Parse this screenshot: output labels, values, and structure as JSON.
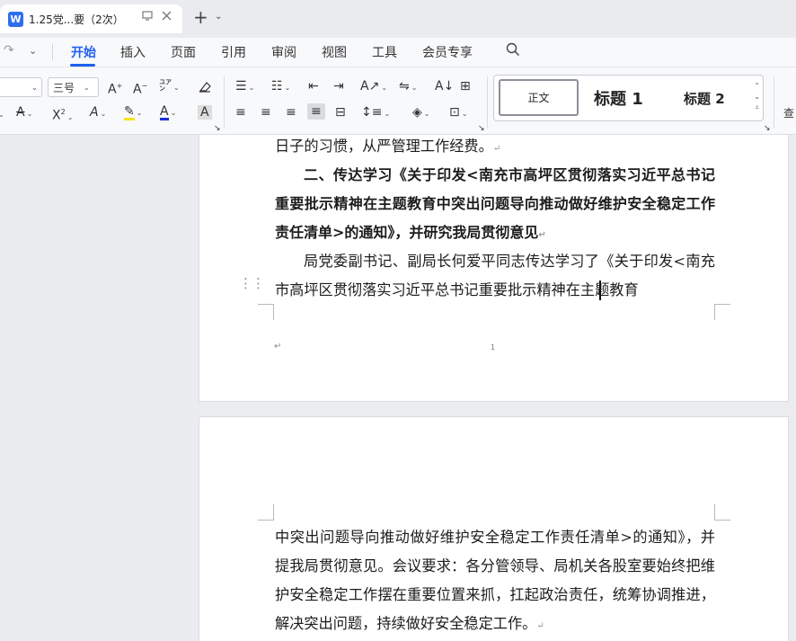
{
  "tab": {
    "icon_letter": "W",
    "title": "1.25党...要（2次）",
    "new_tab": "+"
  },
  "menu": {
    "items": [
      "开始",
      "插入",
      "页面",
      "引用",
      "审阅",
      "视图",
      "工具",
      "会员专享"
    ],
    "active": "开始"
  },
  "ribbon": {
    "font_size_value": "三号",
    "styles": {
      "normal": "正文",
      "heading1": "标题 1",
      "heading2": "标题 2"
    },
    "find_label": "查"
  },
  "document": {
    "page1_lines": [
      "日子的习惯，从严管理工作经费。"
    ],
    "heading_para": "二、传达学习《关于印发<南充市高坪区贯彻落实习近平总书记重要批示精神在主题教育中突出问题导向推动做好维护安全稳定工作责任清单>的通知》，并研究我局贯彻意见",
    "body_para1": "局党委副书记、副局长何爱平同志传达学习了《关于印发<南充市高坪区贯彻落实习近平总书记重要批示精神在主题教育",
    "page_number": "1",
    "page2_para": "中突出问题导向推动做好维护安全稳定工作责任清单>的通知》，并提我局贯彻意见。会议要求：各分管领导、局机关各股室要始终把维护安全稳定工作摆在重要位置来抓，扛起政治责任，统筹协调推进，解决突出问题，持续做好安全稳定工作。"
  },
  "colors": {
    "accent": "#1d5ff0",
    "highlight": "#f5e400",
    "font_color": "#1a2fd6"
  }
}
